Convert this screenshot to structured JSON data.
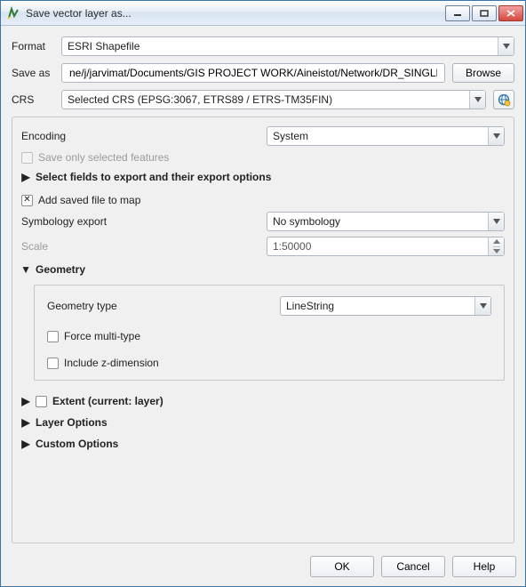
{
  "window": {
    "title": "Save vector layer as..."
  },
  "labels": {
    "format": "Format",
    "saveas": "Save as",
    "crs": "CRS",
    "browse": "Browse",
    "encoding": "Encoding",
    "save_only_selected": "Save only selected features",
    "select_fields": "Select fields to export and their export options",
    "add_to_map": "Add saved file to map",
    "symbology_export": "Symbology export",
    "scale": "Scale",
    "geometry": "Geometry",
    "geometry_type": "Geometry type",
    "force_multi": "Force multi-type",
    "include_z": "Include z-dimension",
    "extent": "Extent (current: layer)",
    "layer_options": "Layer Options",
    "custom_options": "Custom Options",
    "ok": "OK",
    "cancel": "Cancel",
    "help": "Help"
  },
  "values": {
    "format": "ESRI Shapefile",
    "saveas": "ne/j/jarvimat/Documents/GIS PROJECT WORK/Aineistot/Network/DR_SINGLEPART.shp",
    "crs": "Selected CRS (EPSG:3067, ETRS89 / ETRS-TM35FIN)",
    "encoding": "System",
    "symbology": "No symbology",
    "scale": "1:50000",
    "geometry_type": "LineString",
    "add_to_map_checked": true,
    "save_only_selected_checked": false,
    "force_multi_checked": false,
    "include_z_checked": false,
    "extent_checked": false
  }
}
